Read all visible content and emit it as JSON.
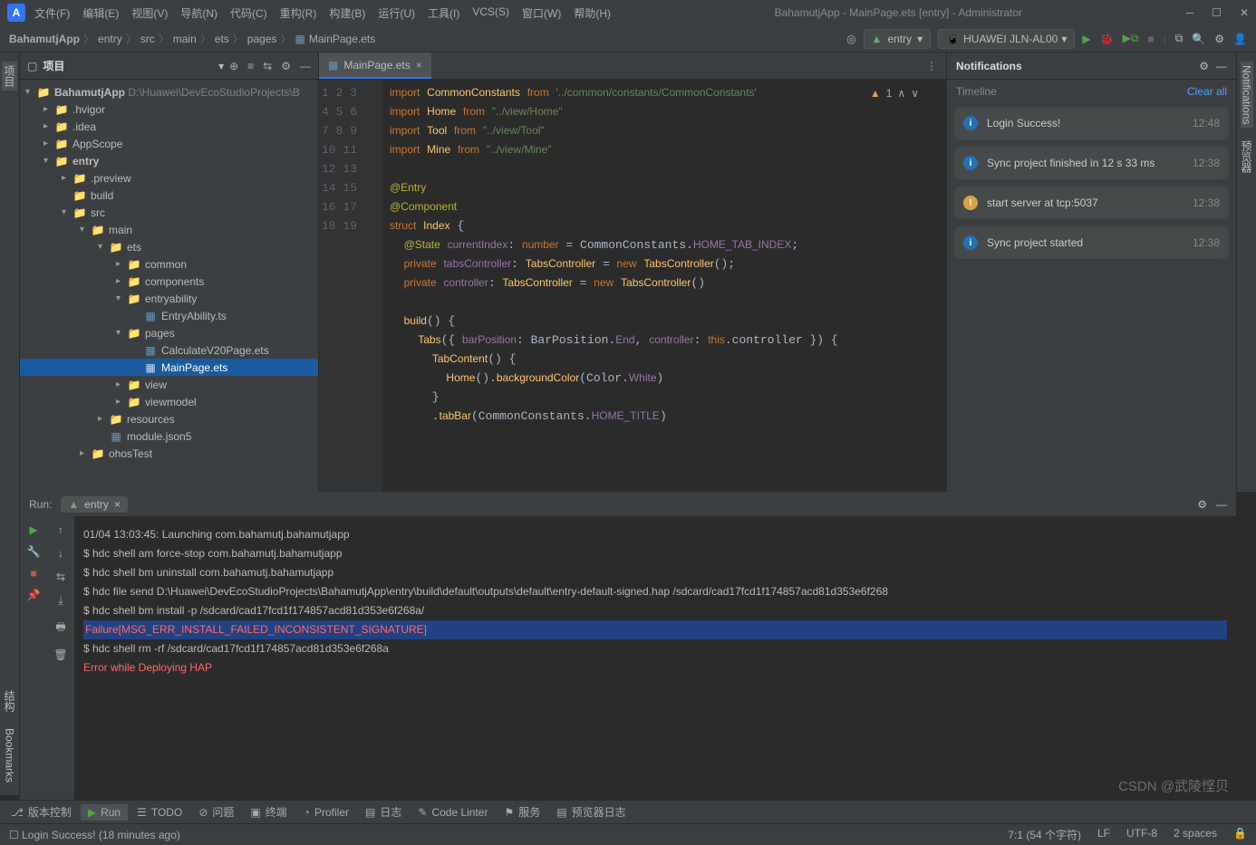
{
  "window": {
    "title": "BahamutjApp - MainPage.ets [entry] - Administrator"
  },
  "menu": {
    "file": "文件(F)",
    "edit": "编辑(E)",
    "view": "视图(V)",
    "nav": "导航(N)",
    "code": "代码(C)",
    "refactor": "重构(R)",
    "build": "构建(B)",
    "run": "运行(U)",
    "tools": "工具(I)",
    "vcs": "VCS(S)",
    "window": "窗口(W)",
    "help": "帮助(H)"
  },
  "breadcrumb": [
    "BahamutjApp",
    "entry",
    "src",
    "main",
    "ets",
    "pages",
    "MainPage.ets"
  ],
  "runConfig": "entry",
  "device": "HUAWEI JLN-AL00",
  "projectPanel": {
    "title": "项目"
  },
  "tree": {
    "root": "BahamutjApp",
    "rootPath": "D:\\Huawei\\DevEcoStudioProjects\\B",
    "hvigor": ".hvigor",
    "idea": ".idea",
    "appscope": "AppScope",
    "entry": "entry",
    "preview": ".preview",
    "build": "build",
    "src": "src",
    "main": "main",
    "ets": "ets",
    "common": "common",
    "components": "components",
    "entryability": "entryability",
    "entryAbilityFile": "EntryAbility.ts",
    "pages": "pages",
    "calcPage": "CalculateV20Page.ets",
    "mainPage": "MainPage.ets",
    "view": "view",
    "viewmodel": "viewmodel",
    "resources": "resources",
    "moduleJson": "module.json5",
    "ohosTest": "ohosTest"
  },
  "editor": {
    "tab": "MainPage.ets",
    "warnCount": "1"
  },
  "code": {
    "lines": [
      "1",
      "2",
      "3",
      "4",
      "5",
      "6",
      "7",
      "8",
      "9",
      "10",
      "11",
      "12",
      "13",
      "14",
      "15",
      "16",
      "17",
      "18",
      "19"
    ]
  },
  "notifications": {
    "title": "Notifications",
    "timeline": "Timeline",
    "clear": "Clear all",
    "items": [
      {
        "type": "info",
        "text": "Login Success!",
        "time": "12:48"
      },
      {
        "type": "info",
        "text": "Sync project finished in 12 s 33 ms",
        "time": "12:38"
      },
      {
        "type": "warn",
        "text": "start server at tcp:5037",
        "time": "12:38"
      },
      {
        "type": "info",
        "text": "Sync project started",
        "time": "12:38"
      }
    ]
  },
  "run": {
    "label": "Run:",
    "tab": "entry",
    "lines": [
      "01/04 13:03:45: Launching com.bahamutj.bahamutjapp",
      "$ hdc shell am force-stop com.bahamutj.bahamutjapp",
      "$ hdc shell bm uninstall com.bahamutj.bahamutjapp",
      "$ hdc file send D:\\Huawei\\DevEcoStudioProjects\\BahamutjApp\\entry\\build\\default\\outputs\\default\\entry-default-signed.hap /sdcard/cad17fcd1f174857acd81d353e6f268",
      "$ hdc shell bm install -p /sdcard/cad17fcd1f174857acd81d353e6f268a/",
      "Failure[MSG_ERR_INSTALL_FAILED_INCONSISTENT_SIGNATURE]",
      "$ hdc shell rm -rf /sdcard/cad17fcd1f174857acd81d353e6f268a",
      "Error while Deploying HAP"
    ]
  },
  "bottomTabs": {
    "vc": "版本控制",
    "run": "Run",
    "todo": "TODO",
    "problems": "问题",
    "terminal": "终端",
    "profiler": "Profiler",
    "log": "日志",
    "lint": "Code Linter",
    "services": "服务",
    "preview": "预览器日志"
  },
  "statusBar": {
    "msg": "Login Success! (18 minutes ago)",
    "pos": "7:1 (54 个字符)",
    "lf": "LF",
    "enc": "UTF-8",
    "indent": "2 spaces"
  },
  "leftGutter": {
    "proj": "项目",
    "struct": "结构",
    "bookmarks": "Bookmarks"
  },
  "rightGutter": {
    "notif": "Notifications",
    "preview": "预览器"
  },
  "watermark": "CSDN @武陵悭贝"
}
